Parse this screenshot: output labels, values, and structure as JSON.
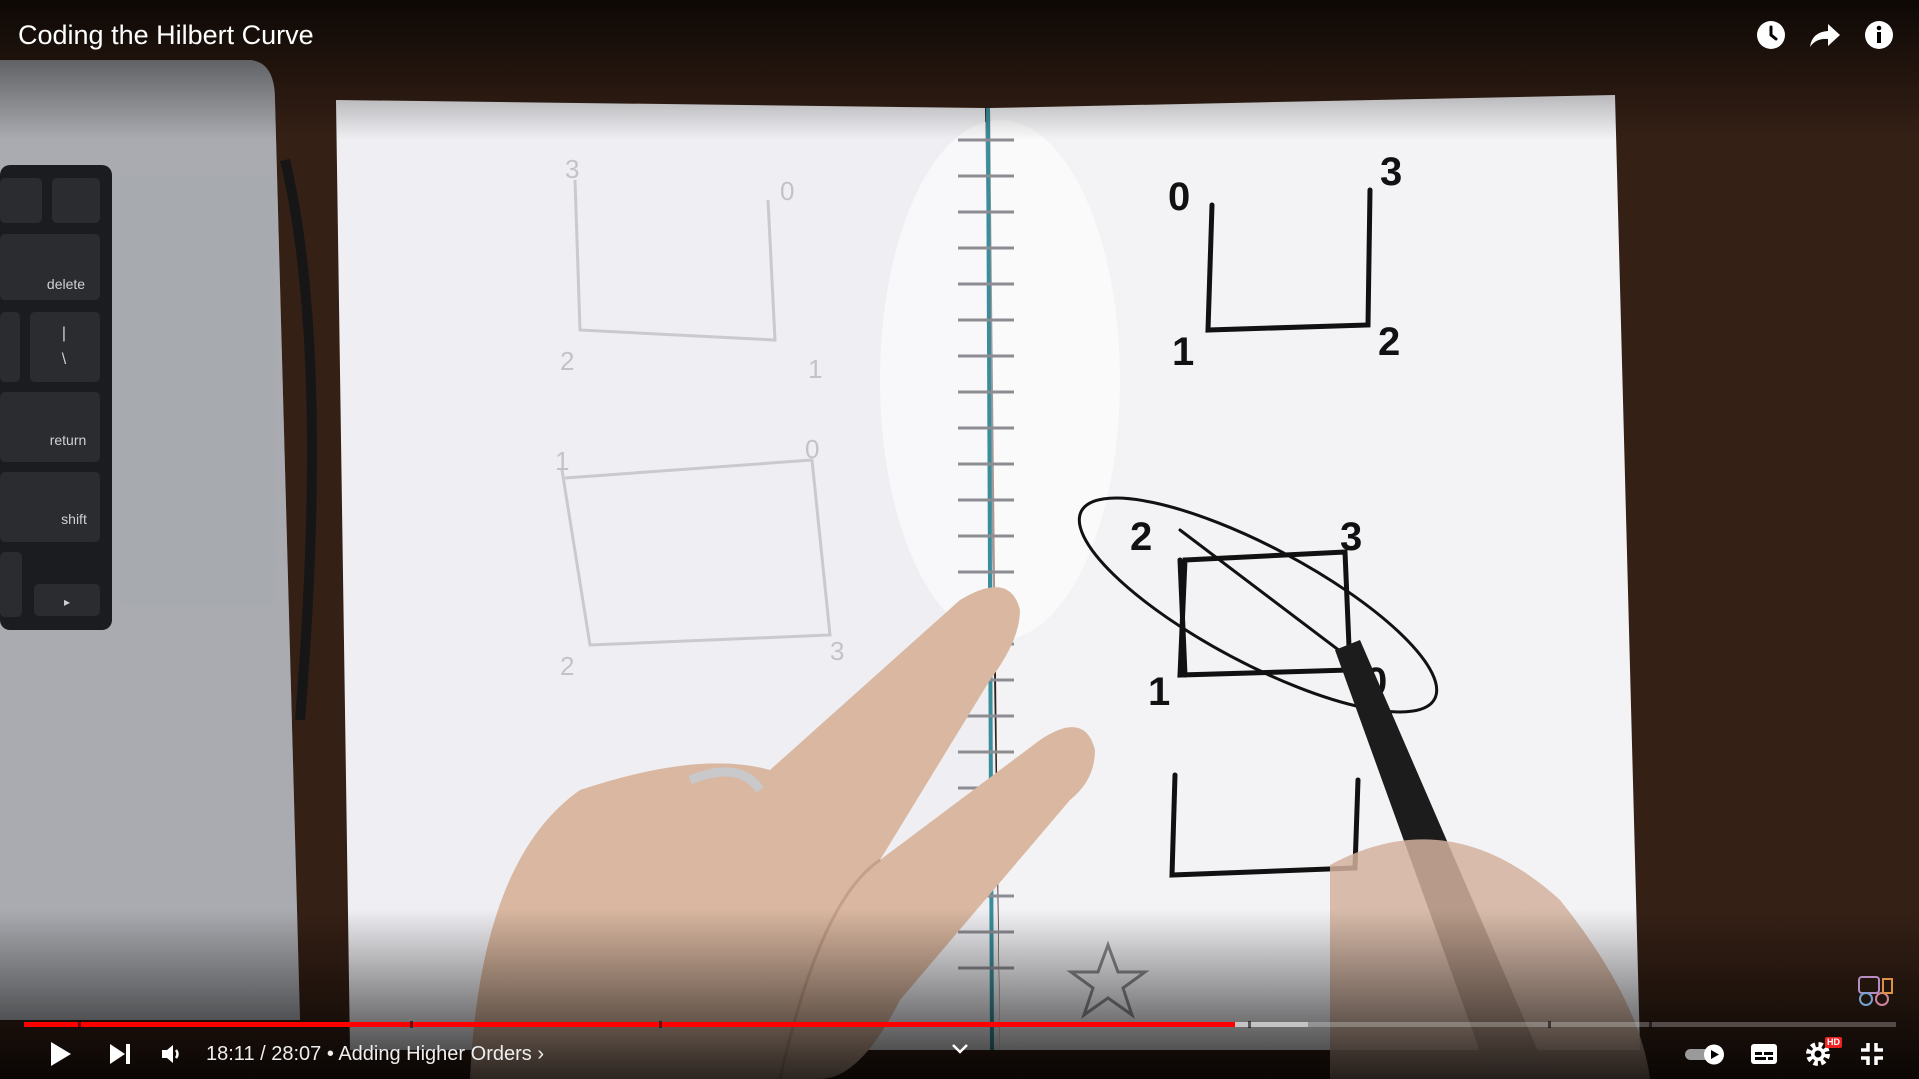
{
  "video": {
    "title": "Coding the Hilbert Curve"
  },
  "top_controls": {
    "icons": [
      "watch-later-icon",
      "share-icon",
      "info-icon"
    ]
  },
  "scene": {
    "keyboard_keys": [
      "delete",
      "|",
      "\\",
      "return",
      "shift",
      "▸"
    ],
    "notebook_left_labels": [
      "3",
      "0",
      "2",
      "1",
      "1",
      "0",
      "2",
      "3"
    ],
    "notebook_right_labels": [
      "0",
      "3",
      "1",
      "2",
      "2",
      "3",
      "1",
      "0"
    ]
  },
  "progress": {
    "played_fraction": 0.647,
    "buffered_fraction": 0.686,
    "chapter_markers_fraction": [
      0.029,
      0.206,
      0.339,
      0.654,
      0.814,
      0.868
    ]
  },
  "controls": {
    "current_time": "18:11",
    "duration": "28:07",
    "separator": " / ",
    "dot": " • ",
    "chapter": "Adding Higher Orders",
    "chapter_chevron": "›",
    "icons": [
      "play-icon",
      "next-icon",
      "volume-icon",
      "autoplay-toggle-icon",
      "subtitles-icon",
      "settings-icon",
      "exit-fullscreen-icon"
    ],
    "hd_badge": "HD"
  },
  "colors": {
    "progress_played": "#ff0000",
    "hd_badge": "#ee2222"
  }
}
